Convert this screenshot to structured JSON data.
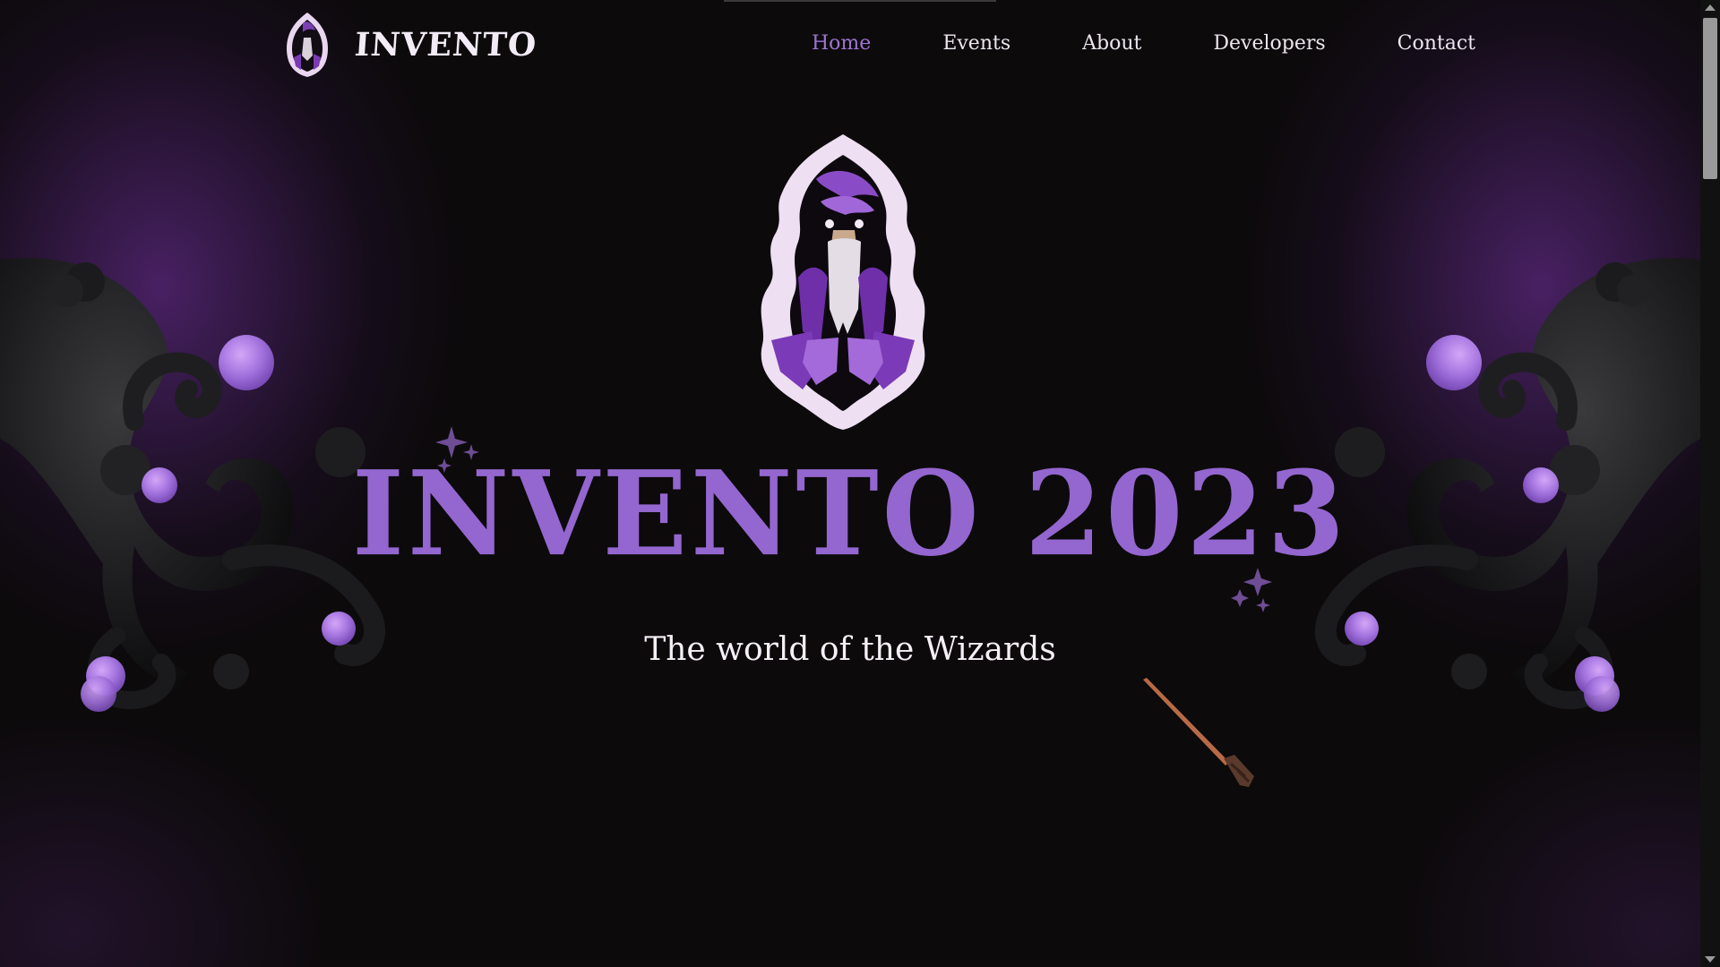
{
  "navbar": {
    "brand_name": "INVENTO",
    "links": [
      {
        "label": "Home",
        "active": true
      },
      {
        "label": "Events",
        "active": false
      },
      {
        "label": "About",
        "active": false
      },
      {
        "label": "Developers",
        "active": false
      },
      {
        "label": "Contact",
        "active": false
      }
    ]
  },
  "hero": {
    "title": "INVENTO 2023",
    "subtitle": "The world of the Wizards"
  },
  "colors": {
    "background": "#0c0a0b",
    "accent_purple": "#9466cf",
    "active_nav": "#9d74d4",
    "orb": "#a676e0",
    "text": "#f4f0f6"
  },
  "icons": [
    "wizard-logo-icon",
    "sparkle-icon",
    "magic-wand-icon",
    "tentacle-vine-decoration"
  ]
}
